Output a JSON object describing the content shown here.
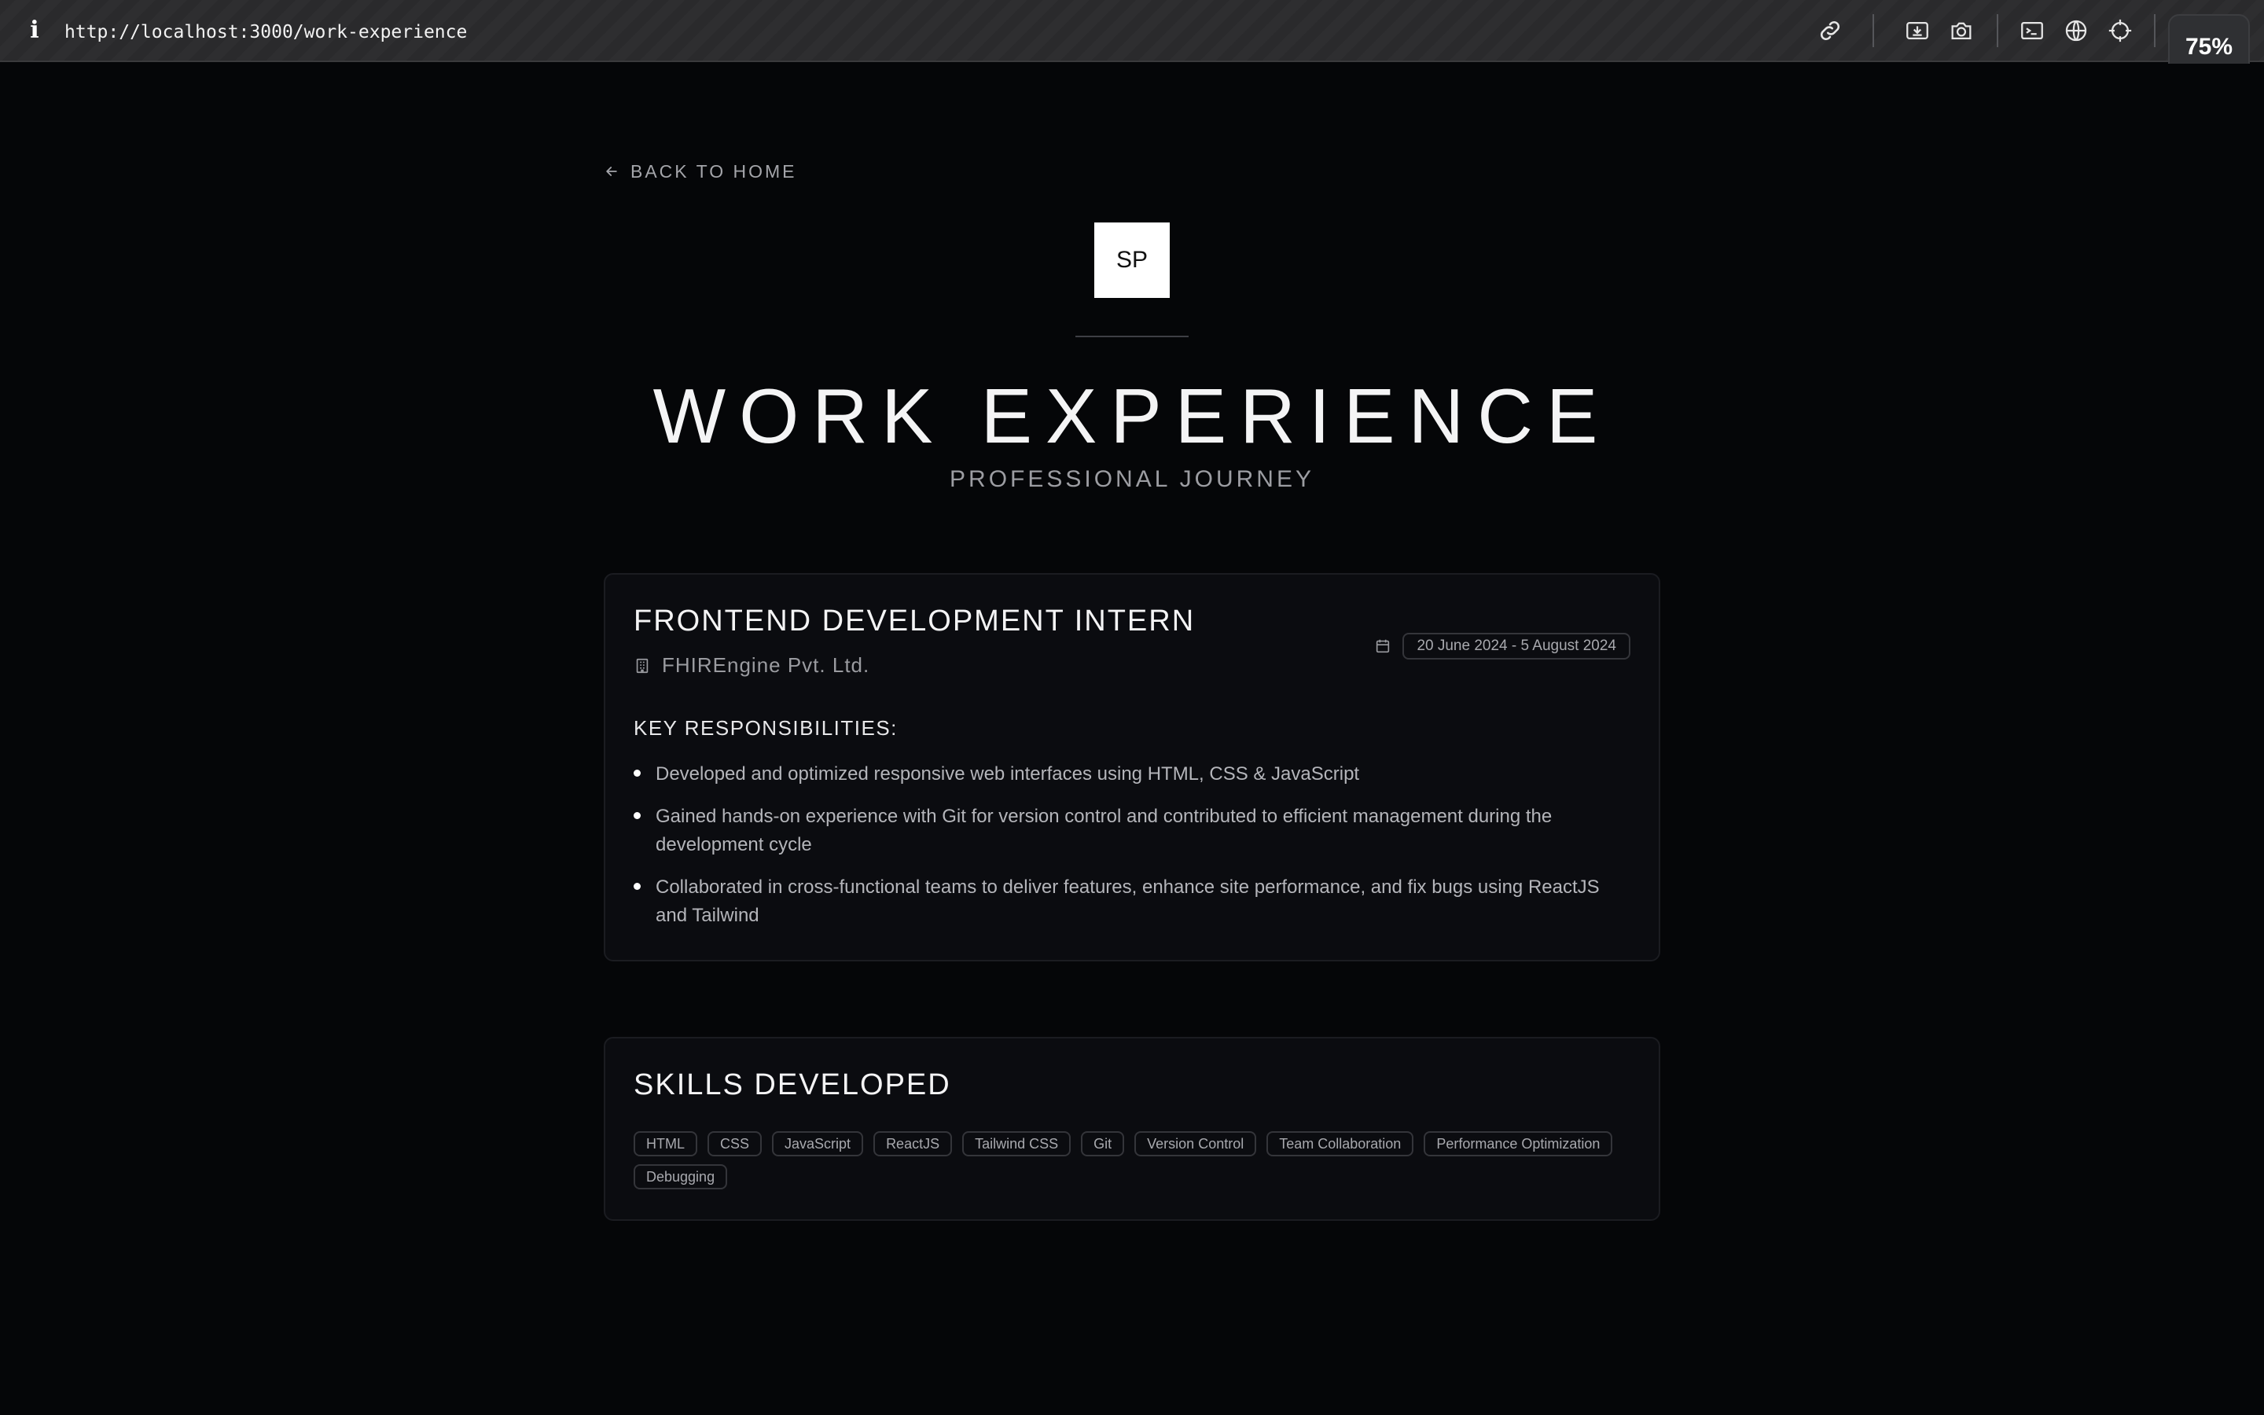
{
  "browser": {
    "url": "http://localhost:3000/work-experience",
    "info_icon": "i",
    "zoom": "75%",
    "icons": [
      "link-icon",
      "download-icon",
      "camera-icon",
      "terminal-icon",
      "globe-icon",
      "crosshair-icon"
    ]
  },
  "nav": {
    "back_label": "BACK TO HOME"
  },
  "logo": {
    "initials": "SP"
  },
  "header": {
    "title": "WORK EXPERIENCE",
    "subtitle": "PROFESSIONAL JOURNEY"
  },
  "job": {
    "title": "FRONTEND DEVELOPMENT INTERN",
    "company": "FHIREngine Pvt. Ltd.",
    "date_range": "20 June 2024 - 5 August 2024",
    "responsibilities_heading": "KEY RESPONSIBILITIES:",
    "responsibilities": [
      "Developed and optimized responsive web interfaces using HTML, CSS & JavaScript",
      "Gained hands-on experience with Git for version control and contributed to efficient management during the development cycle",
      "Collaborated in cross-functional teams to deliver features, enhance site performance, and fix bugs using ReactJS and Tailwind"
    ]
  },
  "skills": {
    "title": "SKILLS DEVELOPED",
    "items": [
      "HTML",
      "CSS",
      "JavaScript",
      "ReactJS",
      "Tailwind CSS",
      "Git",
      "Version Control",
      "Team Collaboration",
      "Performance Optimization",
      "Debugging"
    ]
  },
  "colors": {
    "background": "#050608",
    "card": "#0b0c10",
    "accent": "#ffffff",
    "muted_text": "#9c9da2"
  }
}
